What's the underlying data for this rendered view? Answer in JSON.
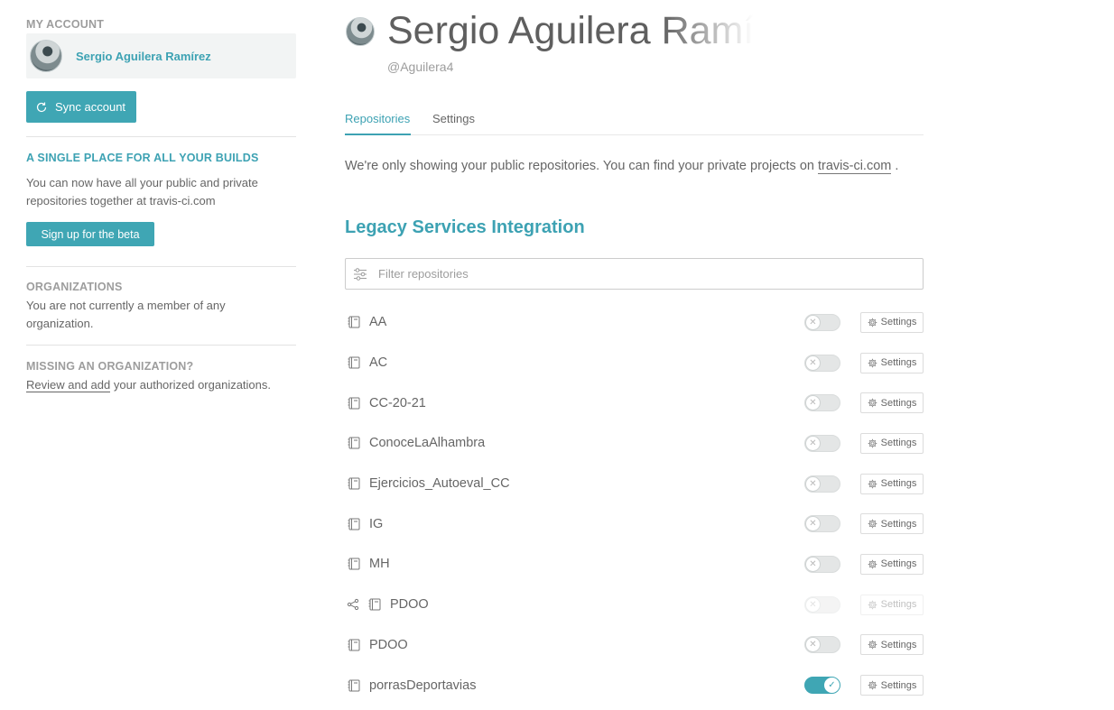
{
  "sidebar": {
    "account_heading": "MY ACCOUNT",
    "account_name": "Sergio Aguilera Ramírez",
    "sync_label": "Sync account",
    "beta_heading": "A SINGLE PLACE FOR ALL YOUR BUILDS",
    "beta_text": "You can now have all your public and private repositories together at travis-ci.com",
    "beta_button": "Sign up for the beta",
    "org_heading": "ORGANIZATIONS",
    "org_text": "You are not currently a member of any organization.",
    "missing_heading": "MISSING AN ORGANIZATION?",
    "missing_link": "Review and add",
    "missing_text": " your authorized organizations."
  },
  "profile": {
    "name": "Sergio Aguilera Ramíre",
    "login": "@Aguilera4"
  },
  "tabs": [
    {
      "label": "Repositories",
      "active": true
    },
    {
      "label": "Settings",
      "active": false
    }
  ],
  "notice": {
    "text": "We're only showing your public repositories. You can find your private projects on ",
    "link": "travis-ci.com",
    "suffix": " ."
  },
  "section_title": "Legacy Services Integration",
  "filter": {
    "placeholder": "Filter repositories"
  },
  "settings_label": "Settings",
  "repos": [
    {
      "name": "AA",
      "enabled": false,
      "forked": false,
      "dim": false
    },
    {
      "name": "AC",
      "enabled": false,
      "forked": false,
      "dim": false
    },
    {
      "name": "CC-20-21",
      "enabled": false,
      "forked": false,
      "dim": false
    },
    {
      "name": "ConoceLaAlhambra",
      "enabled": false,
      "forked": false,
      "dim": false
    },
    {
      "name": "Ejercicios_Autoeval_CC",
      "enabled": false,
      "forked": false,
      "dim": false
    },
    {
      "name": "IG",
      "enabled": false,
      "forked": false,
      "dim": false
    },
    {
      "name": "MH",
      "enabled": false,
      "forked": false,
      "dim": false
    },
    {
      "name": "PDOO",
      "enabled": false,
      "forked": true,
      "dim": true
    },
    {
      "name": "PDOO",
      "enabled": false,
      "forked": false,
      "dim": false
    },
    {
      "name": "porrasDeportavias",
      "enabled": true,
      "forked": false,
      "dim": false
    }
  ],
  "colors": {
    "accent": "#3fa6b4",
    "accent_text": "#3da2b3",
    "text": "#666666",
    "muted": "#9d9d9d",
    "panel": "#f2f4f4"
  },
  "icons": {
    "sync": "sync-icon",
    "filter": "filter-sliders-icon",
    "repo": "repo-book-icon",
    "fork": "fork-icon",
    "gear": "gear-icon",
    "toggle_off": "x-icon",
    "toggle_on": "check-icon"
  }
}
